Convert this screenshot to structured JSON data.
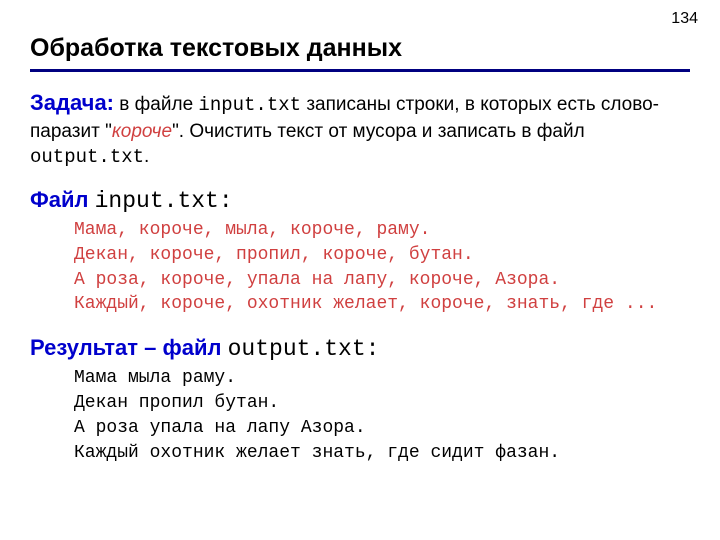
{
  "pageNumber": "134",
  "title": "Обработка текстовых данных",
  "task": {
    "label": "Задача:",
    "part1": " в файле ",
    "file1": "input.txt",
    "part2": " записаны строки, в которых есть слово-паразит \"",
    "parasite": "короче",
    "part3": "\". Очистить текст от мусора и записать в файл ",
    "file2": "output.txt",
    "part4": "."
  },
  "inputSection": {
    "label": "Файл ",
    "filename": "input.txt",
    "colon": ":",
    "lines": [
      "Мама, короче, мыла, короче, раму.",
      "Декан, короче, пропил, короче, бутан.",
      "А роза, короче, упала на лапу, короче, Азора.",
      "Каждый, короче, охотник желает, короче, знать, где ..."
    ]
  },
  "outputSection": {
    "label": "Результат – файл ",
    "filename": "output.txt",
    "colon": ":",
    "lines": [
      "Мама мыла раму.",
      "Декан пропил бутан.",
      "А роза упала на лапу Азора.",
      "Каждый охотник желает знать, где сидит фазан."
    ]
  }
}
